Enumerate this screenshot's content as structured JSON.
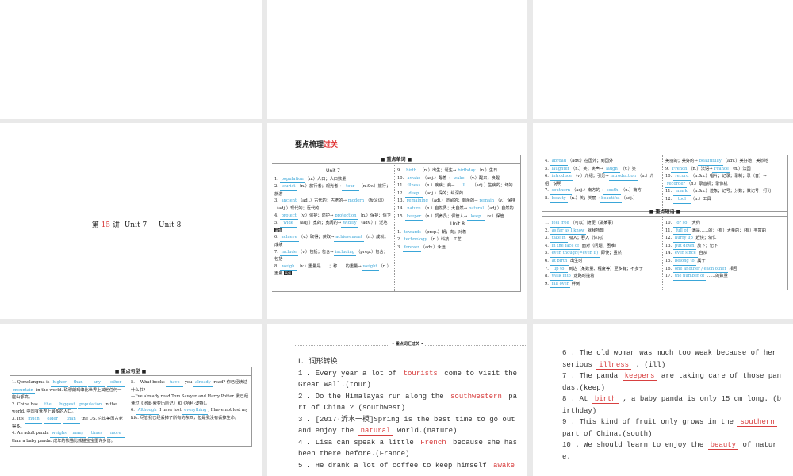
{
  "slide1": {
    "prefix": "第",
    "num": "15",
    "suffix": "讲",
    "title": "Unit 7 — Unit 8"
  },
  "slide2": {
    "title_a": "要点梳理",
    "title_b": "过关",
    "header": "■ 重点单词 ■",
    "unit7": "Unit 7",
    "unit8": "Unit 8",
    "left": [
      [
        "1. ",
        {
          "b": "population"
        },
        "（n.）人口；人口数量"
      ],
      [
        "2. ",
        {
          "b": "tourist"
        },
        "（n.）旅行者；观光者→",
        {
          "b": "tour"
        },
        "（n.&v.）旅行；旅游"
      ],
      [
        "3. ",
        {
          "b": "ancient"
        },
        "（adj.）古代的；古老的→",
        {
          "b": "modern"
        },
        "（反义词）（adj.）现代的；近代的"
      ],
      [
        "4. ",
        {
          "b": "protect"
        },
        "（v.）保护；防护→",
        {
          "b": "protection"
        },
        "（n.）保护；保卫"
      ],
      [
        "5. ",
        {
          "b": "wide"
        },
        "（adj.）宽的；宽阔的→",
        {
          "b": "widely"
        },
        "（adv.）广泛地 ",
        {
          "tag": "高频"
        }
      ],
      [
        "6. ",
        {
          "b": "achieve"
        },
        "（v.）取得；获取→",
        {
          "b": "achievement"
        },
        "（n.）成就；成绩"
      ],
      [
        "7. ",
        {
          "b": "include"
        },
        "（v.）包括；包含→",
        {
          "b": "including"
        },
        "（prep.）包含；包括"
      ],
      [
        "8. ",
        {
          "b": "weigh"
        },
        "（v.）重量是……；称……的重量→",
        {
          "b": "weight"
        },
        "（n.）重量 ",
        {
          "tag": "高频"
        }
      ]
    ],
    "right": [
      [
        "9. ",
        {
          "b": "birth"
        },
        "（n.）出生；诞生→",
        {
          "b": "birthday"
        },
        "（n.）生日"
      ],
      [
        "10. ",
        {
          "b": "awake"
        },
        "（adj.）醒着→",
        {
          "b": "wake"
        },
        "（v.）醒来；唤醒"
      ],
      [
        "11. ",
        {
          "b": "illness"
        },
        "（n.）疾病；病→",
        {
          "b": "ill"
        },
        "（adj.）生病的；坏的"
      ],
      [
        "12. ",
        {
          "b": "deep"
        },
        "（adj.）深的；纵深的"
      ],
      [
        "13. ",
        {
          "b": "remaining"
        },
        "（adj.）遗留的；剩余的→",
        {
          "b": "remain"
        },
        "（v.）保持"
      ],
      [
        "14. ",
        {
          "b": "nature"
        },
        "（n.）自然界；大自然→",
        {
          "b": "natural"
        },
        "（adj.）自然的"
      ],
      [
        "15. ",
        {
          "b": "keeper"
        },
        "（n.）饲养员；保管人→",
        {
          "b": "keep"
        },
        "（v.）保管"
      ]
    ],
    "unit8_items": [
      [
        "1. ",
        {
          "b": "towards"
        },
        "（prep.）朝；向；对着"
      ],
      [
        "2. ",
        {
          "b": "technology"
        },
        "（n.）科技；工艺"
      ],
      [
        "3. ",
        {
          "b": "forever"
        },
        "（adv.）永远"
      ]
    ]
  },
  "slide3": {
    "phrase_header": "■ 重点短语 ■",
    "left": [
      [
        "4. ",
        {
          "b": "abroad"
        },
        "（adv.）在国外；到国外"
      ],
      [
        "5. ",
        {
          "b": "laughter"
        },
        "（n.）笑；笑声→",
        {
          "b": "laugh"
        },
        "（v.）笑"
      ],
      [
        "6. ",
        {
          "b": "introduce"
        },
        "（v.）介绍；引见→",
        {
          "b": "introduction"
        },
        "（n.）介绍；说明"
      ],
      [
        "7. ",
        {
          "b": "southern"
        },
        "（adj.）南方的→",
        {
          "b": "south"
        },
        "（n.）南方"
      ],
      [
        "8. ",
        {
          "b": "beauty"
        },
        "（n.）美；美丽→",
        {
          "b": "beautiful"
        },
        "（adj.）"
      ]
    ],
    "right": [
      [
        "美丽的；美好的→",
        {
          "b": "beautifully"
        },
        "（adv.）美好地；美妙地"
      ],
      [
        "9. ",
        {
          "b": "French"
        },
        "（n.）法语→",
        {
          "b": "France"
        },
        "（n.）法国"
      ],
      [
        "10. ",
        {
          "b": "record"
        },
        "（n.&v.）唱片；记录；录制；录（音）→",
        {
          "b": "recorder"
        },
        "（n.）录音机；录像机"
      ],
      [
        "11. ",
        {
          "b": "mark"
        },
        "（n.&v.）迹象；记号；分数；做记号；打分"
      ],
      [
        "12. ",
        {
          "b": "tool"
        },
        "（n.）工具"
      ]
    ],
    "phrases_left": [
      [
        "1. ",
        {
          "b": "feel free"
        },
        "（可以）随便（做某事）"
      ],
      [
        "2. ",
        {
          "b": "as far as I know"
        },
        " 就我所知"
      ],
      [
        "3. ",
        {
          "b": "take in"
        },
        " 吸入；吞入（体内）"
      ],
      [
        "4. ",
        {
          "b": "in the face of"
        },
        " 面对（问题、困难）"
      ],
      [
        "5. ",
        {
          "b": "even though(=even if)"
        },
        " 即使；虽然"
      ],
      [
        "6. ",
        {
          "b": "at birth"
        },
        " 出生时"
      ],
      [
        "7. ",
        {
          "b": "up to"
        },
        " 到达（某数量、程度等）至多有；不多于"
      ],
      [
        "8. ",
        {
          "b": "walk into"
        },
        " 走路时撞着"
      ],
      [
        "9. ",
        {
          "b": "fall over"
        },
        " 绊倒"
      ]
    ],
    "phrases_right": [
      [
        "10. ",
        {
          "b": "or so"
        },
        " 大约"
      ],
      [
        "11. ",
        {
          "b": "full of"
        },
        " 满是……的；（有）大量的；（有）丰富的"
      ],
      [
        "12. ",
        {
          "b": "hurry up"
        },
        " 赶快；匆忙"
      ],
      [
        "13. ",
        {
          "b": "put down"
        },
        " 放下；记下"
      ],
      [
        "14. ",
        {
          "b": "ever since"
        },
        " 自从"
      ],
      [
        "15. ",
        {
          "b": "belong to"
        },
        " 属于"
      ],
      [
        "16. ",
        {
          "b": "one another / each other"
        },
        " 相互"
      ],
      [
        "17. ",
        {
          "b": "the number of"
        },
        " ……的数量"
      ]
    ]
  },
  "slide4": {
    "header": "■ 重点句型 ■",
    "left": [
      [
        "1. Qomolangma is ",
        {
          "b": "higher"
        },
        " ",
        {
          "b": "than"
        },
        " ",
        {
          "b": "any"
        },
        " ",
        {
          "b": "other"
        },
        " ",
        {
          "b": "mountain"
        },
        " in the world. 珠穆朗玛峰比世界上其他任何一座山都高。"
      ],
      [
        "2. China has ",
        {
          "b": "the"
        },
        " ",
        {
          "b": "biggest"
        },
        " ",
        {
          "b": "population"
        },
        " in the world. 中国有世界上最多的人口。"
      ],
      [
        "3. It's ",
        {
          "b": "much"
        },
        " ",
        {
          "b": "older"
        },
        " ",
        {
          "b": "than"
        },
        " the US. 它比美国古老得多。"
      ],
      [
        "4. An adult panda ",
        {
          "b": "weighs"
        },
        " ",
        {
          "b": "many"
        },
        " ",
        {
          "b": "times"
        },
        " ",
        {
          "b": "more"
        },
        " than a baby panda. 成年的熊猫比熊猫宝宝重许多倍。"
      ]
    ],
    "right": [
      [
        "5. —What books ",
        {
          "b": "have"
        },
        " you ",
        {
          "b": "already"
        },
        " read? 你已经读过什么书？"
      ],
      [
        "—I've already read Tom Sawyer and Harry Potter. 我已经读过《汤姆·索亚历险记》和《哈利·波特》。"
      ],
      [
        "6. ",
        {
          "b": "Although"
        },
        " I have lost ",
        {
          "b": "everything"
        },
        ", I have not lost my life. 尽管我已经丢掉了所有的东西，但是我没有丢掉生命。"
      ]
    ]
  },
  "slide5": {
    "banner": "• 重点词汇过关 •",
    "section": "Ⅰ. 词形转换",
    "items": [
      [
        "1 .  Every year a lot of ",
        {
          "r": "tourists"
        },
        " come to visit the Great Wall.(tour)"
      ],
      [
        "2 .  Do the Himalayas run along the ",
        {
          "r": "southwestern"
        },
        " part of China ? (southwest)"
      ],
      [
        "3 .  [2017·沂水一模]Spring is the best time to go out and enjoy the ",
        {
          "r": "natural"
        },
        " world.(nature)"
      ],
      [
        "4 .  Lisa can speak a little ",
        {
          "r": "French"
        },
        " because she has been there before.(France)"
      ],
      [
        "5 .  He drank a lot of coffee to keep himself ",
        {
          "r": "awake"
        }
      ]
    ]
  },
  "slide6": {
    "items": [
      [
        "6 .  The old woman was much too weak because of her serious ",
        {
          "r": "illness"
        },
        " .  (ill)"
      ],
      [
        "7 .  The panda ",
        {
          "r": "keepers"
        },
        " are taking care of those pandas.(keep)"
      ],
      [
        "8 .  At ",
        {
          "r": "birth"
        },
        " ,  a baby panda is only 15 cm long. (birthday)"
      ],
      [
        "9 .  This kind of fruit only grows in the ",
        {
          "r": "southern"
        },
        " part of China.(south)"
      ],
      [
        "10 .  We should learn to enjoy the ",
        {
          "r": "beauty"
        },
        " of nature."
      ]
    ]
  }
}
